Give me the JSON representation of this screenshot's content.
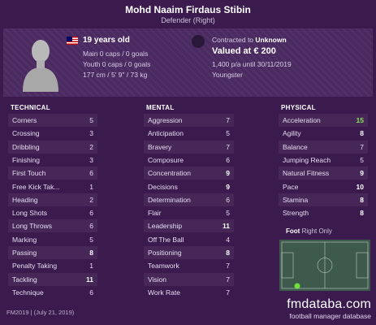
{
  "player": {
    "name": "Mohd Naaim Firdaus Stibin",
    "position": "Defender (Right)",
    "age": "19 years old",
    "main_caps": "Main 0 caps / 0 goals",
    "youth_caps": "Youth 0 caps / 0 goals",
    "height_weight": "177 cm / 5' 9\" / 73 kg"
  },
  "contract": {
    "label": "Contracted to",
    "club": "Unknown",
    "value": "Valued at € 200",
    "wage": "1,400 p/a until 30/11/2019",
    "status": "Youngster"
  },
  "icons": {
    "avatar": "person-silhouette-icon",
    "flag": "malaysia-flag-icon",
    "club": "club-badge-icon"
  },
  "colors": {
    "background": "#3b1a4e",
    "panel": "#4a2a60",
    "highlight_value": "#8be35a",
    "pitch": "#3e5a4c",
    "position_marker": "#6fe03c"
  },
  "sections": {
    "technical": {
      "title": "TECHNICAL",
      "attributes": [
        {
          "name": "Corners",
          "value": "5"
        },
        {
          "name": "Crossing",
          "value": "3"
        },
        {
          "name": "Dribbling",
          "value": "2"
        },
        {
          "name": "Finishing",
          "value": "3"
        },
        {
          "name": "First Touch",
          "value": "6"
        },
        {
          "name": "Free Kick Tak...",
          "value": "1"
        },
        {
          "name": "Heading",
          "value": "2"
        },
        {
          "name": "Long Shots",
          "value": "6"
        },
        {
          "name": "Long Throws",
          "value": "6"
        },
        {
          "name": "Marking",
          "value": "5"
        },
        {
          "name": "Passing",
          "value": "8"
        },
        {
          "name": "Penalty Taking",
          "value": "1"
        },
        {
          "name": "Tackling",
          "value": "11"
        },
        {
          "name": "Technique",
          "value": "6"
        }
      ]
    },
    "mental": {
      "title": "MENTAL",
      "attributes": [
        {
          "name": "Aggression",
          "value": "7"
        },
        {
          "name": "Anticipation",
          "value": "5"
        },
        {
          "name": "Bravery",
          "value": "7"
        },
        {
          "name": "Composure",
          "value": "6"
        },
        {
          "name": "Concentration",
          "value": "9"
        },
        {
          "name": "Decisions",
          "value": "9"
        },
        {
          "name": "Determination",
          "value": "6"
        },
        {
          "name": "Flair",
          "value": "5"
        },
        {
          "name": "Leadership",
          "value": "11"
        },
        {
          "name": "Off The Ball",
          "value": "4"
        },
        {
          "name": "Positioning",
          "value": "8"
        },
        {
          "name": "Teamwork",
          "value": "7"
        },
        {
          "name": "Vision",
          "value": "7"
        },
        {
          "name": "Work Rate",
          "value": "7"
        }
      ]
    },
    "physical": {
      "title": "PHYSICAL",
      "attributes": [
        {
          "name": "Acceleration",
          "value": "15"
        },
        {
          "name": "Agility",
          "value": "8"
        },
        {
          "name": "Balance",
          "value": "7"
        },
        {
          "name": "Jumping Reach",
          "value": "5"
        },
        {
          "name": "Natural Fitness",
          "value": "9"
        },
        {
          "name": "Pace",
          "value": "10"
        },
        {
          "name": "Stamina",
          "value": "8"
        },
        {
          "name": "Strength",
          "value": "8"
        }
      ]
    }
  },
  "foot": {
    "label": "Foot",
    "value": "Right Only"
  },
  "footer": {
    "version": "FM2019 | (July 21, 2019)",
    "brand": "fmdataba.com",
    "brand_sub": "football manager database"
  }
}
